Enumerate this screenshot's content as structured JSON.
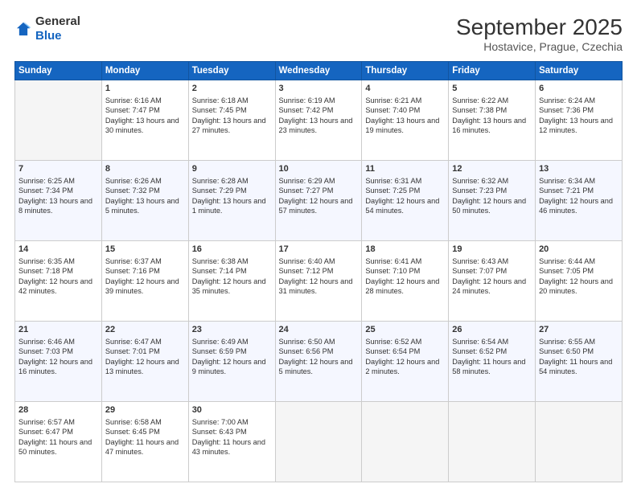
{
  "header": {
    "logo_line1": "General",
    "logo_line2": "Blue",
    "month": "September 2025",
    "location": "Hostavice, Prague, Czechia"
  },
  "days_of_week": [
    "Sunday",
    "Monday",
    "Tuesday",
    "Wednesday",
    "Thursday",
    "Friday",
    "Saturday"
  ],
  "weeks": [
    [
      {
        "day": "",
        "sunrise": "",
        "sunset": "",
        "daylight": ""
      },
      {
        "day": "1",
        "sunrise": "Sunrise: 6:16 AM",
        "sunset": "Sunset: 7:47 PM",
        "daylight": "Daylight: 13 hours and 30 minutes."
      },
      {
        "day": "2",
        "sunrise": "Sunrise: 6:18 AM",
        "sunset": "Sunset: 7:45 PM",
        "daylight": "Daylight: 13 hours and 27 minutes."
      },
      {
        "day": "3",
        "sunrise": "Sunrise: 6:19 AM",
        "sunset": "Sunset: 7:42 PM",
        "daylight": "Daylight: 13 hours and 23 minutes."
      },
      {
        "day": "4",
        "sunrise": "Sunrise: 6:21 AM",
        "sunset": "Sunset: 7:40 PM",
        "daylight": "Daylight: 13 hours and 19 minutes."
      },
      {
        "day": "5",
        "sunrise": "Sunrise: 6:22 AM",
        "sunset": "Sunset: 7:38 PM",
        "daylight": "Daylight: 13 hours and 16 minutes."
      },
      {
        "day": "6",
        "sunrise": "Sunrise: 6:24 AM",
        "sunset": "Sunset: 7:36 PM",
        "daylight": "Daylight: 13 hours and 12 minutes."
      }
    ],
    [
      {
        "day": "7",
        "sunrise": "Sunrise: 6:25 AM",
        "sunset": "Sunset: 7:34 PM",
        "daylight": "Daylight: 13 hours and 8 minutes."
      },
      {
        "day": "8",
        "sunrise": "Sunrise: 6:26 AM",
        "sunset": "Sunset: 7:32 PM",
        "daylight": "Daylight: 13 hours and 5 minutes."
      },
      {
        "day": "9",
        "sunrise": "Sunrise: 6:28 AM",
        "sunset": "Sunset: 7:29 PM",
        "daylight": "Daylight: 13 hours and 1 minute."
      },
      {
        "day": "10",
        "sunrise": "Sunrise: 6:29 AM",
        "sunset": "Sunset: 7:27 PM",
        "daylight": "Daylight: 12 hours and 57 minutes."
      },
      {
        "day": "11",
        "sunrise": "Sunrise: 6:31 AM",
        "sunset": "Sunset: 7:25 PM",
        "daylight": "Daylight: 12 hours and 54 minutes."
      },
      {
        "day": "12",
        "sunrise": "Sunrise: 6:32 AM",
        "sunset": "Sunset: 7:23 PM",
        "daylight": "Daylight: 12 hours and 50 minutes."
      },
      {
        "day": "13",
        "sunrise": "Sunrise: 6:34 AM",
        "sunset": "Sunset: 7:21 PM",
        "daylight": "Daylight: 12 hours and 46 minutes."
      }
    ],
    [
      {
        "day": "14",
        "sunrise": "Sunrise: 6:35 AM",
        "sunset": "Sunset: 7:18 PM",
        "daylight": "Daylight: 12 hours and 42 minutes."
      },
      {
        "day": "15",
        "sunrise": "Sunrise: 6:37 AM",
        "sunset": "Sunset: 7:16 PM",
        "daylight": "Daylight: 12 hours and 39 minutes."
      },
      {
        "day": "16",
        "sunrise": "Sunrise: 6:38 AM",
        "sunset": "Sunset: 7:14 PM",
        "daylight": "Daylight: 12 hours and 35 minutes."
      },
      {
        "day": "17",
        "sunrise": "Sunrise: 6:40 AM",
        "sunset": "Sunset: 7:12 PM",
        "daylight": "Daylight: 12 hours and 31 minutes."
      },
      {
        "day": "18",
        "sunrise": "Sunrise: 6:41 AM",
        "sunset": "Sunset: 7:10 PM",
        "daylight": "Daylight: 12 hours and 28 minutes."
      },
      {
        "day": "19",
        "sunrise": "Sunrise: 6:43 AM",
        "sunset": "Sunset: 7:07 PM",
        "daylight": "Daylight: 12 hours and 24 minutes."
      },
      {
        "day": "20",
        "sunrise": "Sunrise: 6:44 AM",
        "sunset": "Sunset: 7:05 PM",
        "daylight": "Daylight: 12 hours and 20 minutes."
      }
    ],
    [
      {
        "day": "21",
        "sunrise": "Sunrise: 6:46 AM",
        "sunset": "Sunset: 7:03 PM",
        "daylight": "Daylight: 12 hours and 16 minutes."
      },
      {
        "day": "22",
        "sunrise": "Sunrise: 6:47 AM",
        "sunset": "Sunset: 7:01 PM",
        "daylight": "Daylight: 12 hours and 13 minutes."
      },
      {
        "day": "23",
        "sunrise": "Sunrise: 6:49 AM",
        "sunset": "Sunset: 6:59 PM",
        "daylight": "Daylight: 12 hours and 9 minutes."
      },
      {
        "day": "24",
        "sunrise": "Sunrise: 6:50 AM",
        "sunset": "Sunset: 6:56 PM",
        "daylight": "Daylight: 12 hours and 5 minutes."
      },
      {
        "day": "25",
        "sunrise": "Sunrise: 6:52 AM",
        "sunset": "Sunset: 6:54 PM",
        "daylight": "Daylight: 12 hours and 2 minutes."
      },
      {
        "day": "26",
        "sunrise": "Sunrise: 6:54 AM",
        "sunset": "Sunset: 6:52 PM",
        "daylight": "Daylight: 11 hours and 58 minutes."
      },
      {
        "day": "27",
        "sunrise": "Sunrise: 6:55 AM",
        "sunset": "Sunset: 6:50 PM",
        "daylight": "Daylight: 11 hours and 54 minutes."
      }
    ],
    [
      {
        "day": "28",
        "sunrise": "Sunrise: 6:57 AM",
        "sunset": "Sunset: 6:47 PM",
        "daylight": "Daylight: 11 hours and 50 minutes."
      },
      {
        "day": "29",
        "sunrise": "Sunrise: 6:58 AM",
        "sunset": "Sunset: 6:45 PM",
        "daylight": "Daylight: 11 hours and 47 minutes."
      },
      {
        "day": "30",
        "sunrise": "Sunrise: 7:00 AM",
        "sunset": "Sunset: 6:43 PM",
        "daylight": "Daylight: 11 hours and 43 minutes."
      },
      {
        "day": "",
        "sunrise": "",
        "sunset": "",
        "daylight": ""
      },
      {
        "day": "",
        "sunrise": "",
        "sunset": "",
        "daylight": ""
      },
      {
        "day": "",
        "sunrise": "",
        "sunset": "",
        "daylight": ""
      },
      {
        "day": "",
        "sunrise": "",
        "sunset": "",
        "daylight": ""
      }
    ]
  ]
}
